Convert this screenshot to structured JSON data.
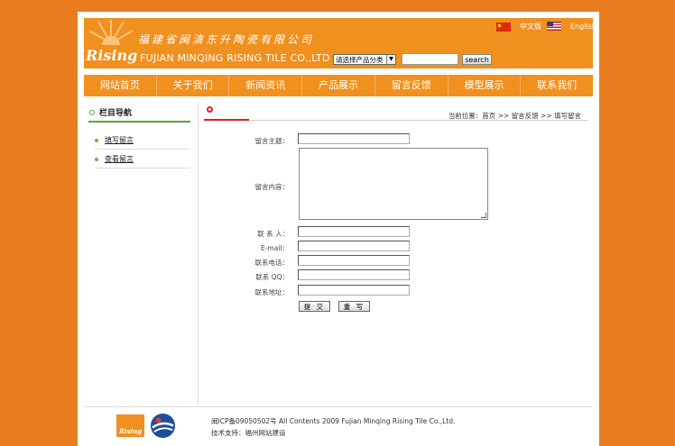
{
  "header": {
    "company_cn": "福建省闽清东升陶瓷有限公司",
    "logo_text": "Rising",
    "company_en": "FUJIAN MINQING RISING TILE CO.,LTD",
    "lang_cn": "中文版",
    "lang_en": "English",
    "category_select": "请选择产品分类",
    "search_button": "search"
  },
  "nav": [
    "网站首页",
    "关于我们",
    "新闻资讯",
    "产品展示",
    "留言反馈",
    "模型展示",
    "联系我们"
  ],
  "sidebar": {
    "title": "栏目导航",
    "items": [
      "填写留言",
      "查看留言"
    ]
  },
  "breadcrumb": "当前位置：首页 >> 留言反馈 >> 填写留言",
  "form": {
    "subject_label": "留言主题：",
    "content_label": "留言内容：",
    "contact_label": "联 系 人：",
    "email_label": "E-mail：",
    "phone_label": "联系电话：",
    "qq_label": "联系 QQ：",
    "address_label": "联系地址：",
    "submit_label": "提 交",
    "reset_label": "重 写"
  },
  "footer": {
    "logo_text": "Rising",
    "copyright": "闽ICP备09050502号 All Contents 2009 Fujian Minqing Rising Tile Co.,Ltd.",
    "support": "技术支持：福州网站建设"
  },
  "colors": {
    "background": "#e87c1e",
    "brand_orange": "#f0901e",
    "accent_green": "#56a33a",
    "accent_red": "#d8232a"
  }
}
